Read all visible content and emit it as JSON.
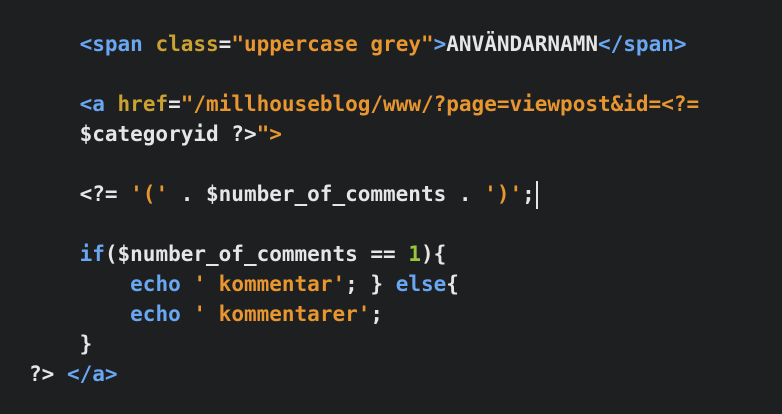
{
  "code": {
    "line1": {
      "indent": "    ",
      "open_tag": "<span",
      "space": " ",
      "attr": "class",
      "eq": "=",
      "value": "\"uppercase grey\"",
      "close_bracket": ">",
      "text": "ANVÄNDARNAMN",
      "end_tag": "</span>"
    },
    "line2": {
      "indent": "    ",
      "open_tag": "<a",
      "space": " ",
      "attr": "href",
      "eq": "=",
      "value": "\"/millhouseblog/www/?page=viewpost&id=<?="
    },
    "line3": {
      "indent": "    ",
      "text": "$categoryid ?>",
      "value_end": "\">"
    },
    "line4": {
      "indent": "    ",
      "open": "<?= ",
      "str1": "'('",
      "mid": " . $number_of_comments . ",
      "str2": "')'",
      "end": ";"
    },
    "line5": {
      "indent": "    ",
      "kw": "if",
      "text": "($number_of_comments == ",
      "num": "1",
      "end": "){"
    },
    "line6": {
      "indent": "        ",
      "kw": "echo",
      "space": " ",
      "str": "' kommentar'",
      "mid": "; } ",
      "kw2": "else",
      "end": "{"
    },
    "line7": {
      "indent": "        ",
      "kw": "echo",
      "space": " ",
      "str": "' kommentarer'",
      "end": ";"
    },
    "line8": {
      "indent": "    ",
      "text": "}"
    },
    "line9": {
      "text": "?>",
      "space": " ",
      "end_tag": "</a>"
    }
  }
}
